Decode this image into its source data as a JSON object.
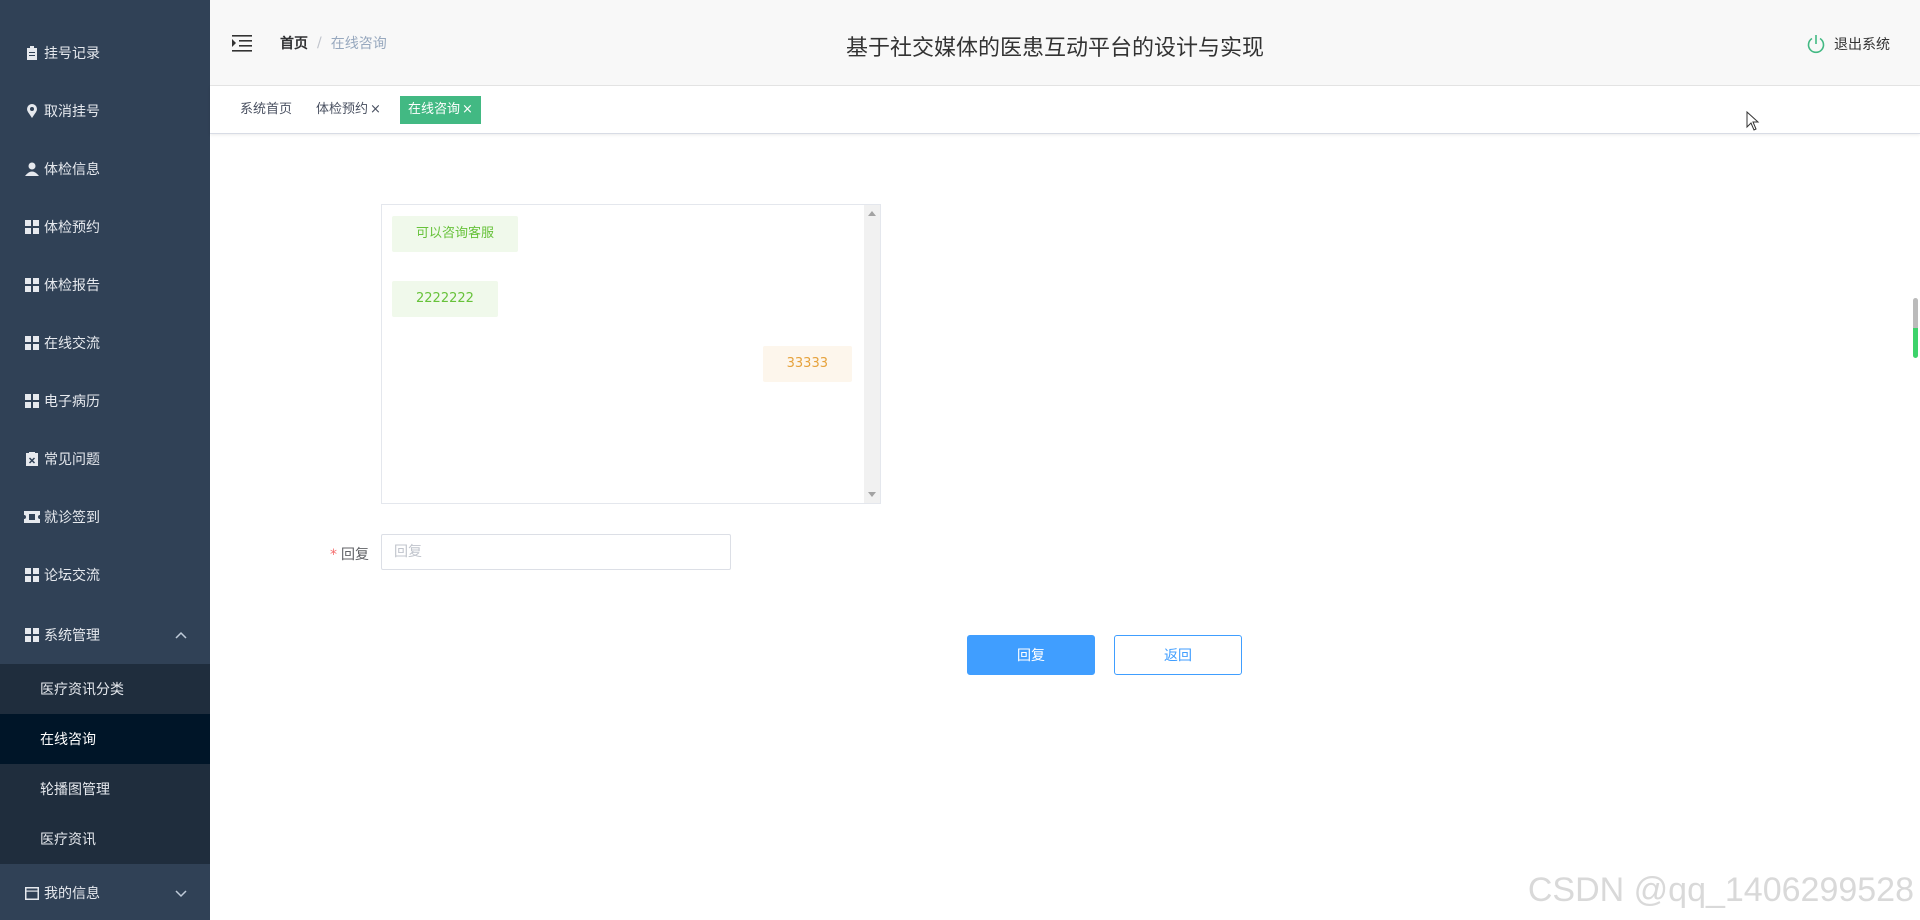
{
  "sidebar": {
    "items": [
      {
        "label": "挂号记录",
        "icon": "clipboard-icon"
      },
      {
        "label": "取消挂号",
        "icon": "location-icon"
      },
      {
        "label": "体检信息",
        "icon": "user-icon"
      },
      {
        "label": "体检预约",
        "icon": "grid-icon"
      },
      {
        "label": "体检报告",
        "icon": "grid-icon"
      },
      {
        "label": "在线交流",
        "icon": "grid-icon"
      },
      {
        "label": "电子病历",
        "icon": "grid-icon"
      },
      {
        "label": "常见问题",
        "icon": "document-x-icon"
      },
      {
        "label": "就诊签到",
        "icon": "ticket-icon"
      },
      {
        "label": "论坛交流",
        "icon": "grid-icon"
      },
      {
        "label": "系统管理",
        "icon": "grid-icon"
      }
    ],
    "subitems": [
      {
        "label": "医疗资讯分类"
      },
      {
        "label": "在线咨询"
      },
      {
        "label": "轮播图管理"
      },
      {
        "label": "医疗资讯"
      }
    ],
    "last": {
      "label": "我的信息",
      "icon": "window-icon"
    }
  },
  "header": {
    "breadcrumb_home": "首页",
    "breadcrumb_sep": "/",
    "breadcrumb_current": "在线咨询",
    "title": "基于社交媒体的医患互动平台的设计与实现",
    "logout_label": "退出系统"
  },
  "tags": {
    "items": [
      "系统首页",
      "体检预约",
      "在线咨询"
    ],
    "close": "×"
  },
  "chat": {
    "messages": [
      {
        "text": "可以咨询客服",
        "side": "left"
      },
      {
        "text": "2222222",
        "side": "left"
      },
      {
        "text": "33333",
        "side": "right"
      }
    ]
  },
  "reply": {
    "required_mark": "*",
    "label": "回复",
    "placeholder": "回复",
    "value": ""
  },
  "buttons": {
    "reply_label": "回复",
    "back_label": "返回"
  },
  "watermark": "CSDN @qq_1406299528",
  "colors": {
    "sidebar_bg": "#304156",
    "active_tag": "#42b983",
    "primary": "#409eff"
  }
}
